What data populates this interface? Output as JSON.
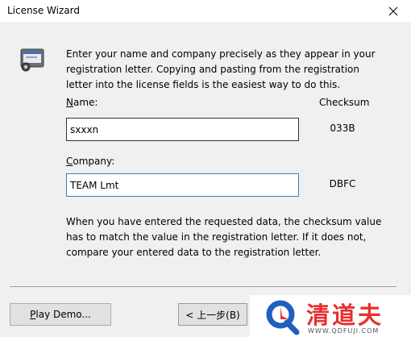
{
  "window": {
    "title": "License Wizard",
    "close_icon": "close-icon"
  },
  "intro_text": "Enter your name and company precisely as they appear in your registration letter.  Copying and pasting from the registration letter into the license fields is the easiest way to do this.",
  "form": {
    "name_label_key": "N",
    "name_label_rest": "ame:",
    "name_value": "sxxxn",
    "name_checksum": "033B",
    "company_label_key": "C",
    "company_label_rest": "ompany:",
    "company_value": "TEAM Lmt",
    "company_checksum": "DBFC",
    "checksum_header": "Checksum"
  },
  "outro_text": "When you have entered the requested data, the checksum value has to match the value in the registration letter.  If it does not, compare your entered data to the registration letter.",
  "buttons": {
    "play_demo_key": "P",
    "play_demo_rest": "lay Demo...",
    "back": "< 上一步(B)"
  },
  "watermark": {
    "brand": "清道夫",
    "url": "WWW.QDFUJI.COM",
    "logo_icon": "magnifier-logo-icon",
    "colors": {
      "red": "#e8302f",
      "blue": "#1e5fbf"
    }
  },
  "colors": {
    "focus_border": "#3c7fb1",
    "dialog_bg": "#f0f0f0"
  }
}
